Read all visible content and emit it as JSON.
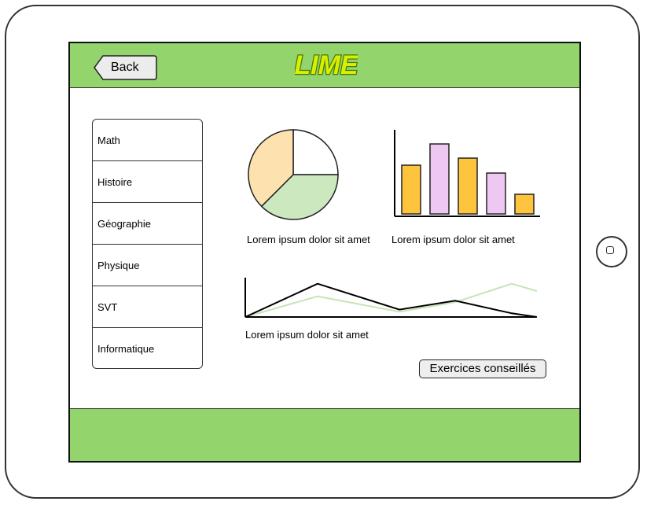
{
  "header": {
    "back_label": "Back",
    "logo_text": "LIME"
  },
  "sidebar": {
    "items": [
      {
        "label": "Math"
      },
      {
        "label": "Histoire"
      },
      {
        "label": "Géographie"
      },
      {
        "label": "Physique"
      },
      {
        "label": "SVT"
      },
      {
        "label": "Informatique"
      }
    ]
  },
  "charts": {
    "pie_caption": "Lorem ipsum dolor sit amet",
    "bar_caption": "Lorem ipsum dolor sit amet",
    "line_caption": "Lorem ipsum dolor sit amet"
  },
  "actions": {
    "exercises_label": "Exercices conseillés"
  },
  "colors": {
    "brand_green": "#93d46c",
    "pie_orange": "#fde2b0",
    "pie_green": "#cbe8bf",
    "bar_orange": "#ffc43d",
    "bar_purple": "#eec7f2",
    "line_dark": "#000000",
    "line_light": "#c6e4b8"
  },
  "icons": {
    "home": "home-button-icon",
    "back": "back-arrow-icon"
  },
  "chart_data": [
    {
      "type": "pie",
      "values": [
        25,
        37.5,
        37.5
      ],
      "colors": [
        "#ffffff",
        "#cbe8bf",
        "#fde2b0"
      ],
      "title": ""
    },
    {
      "type": "bar",
      "categories": [
        "1",
        "2",
        "3",
        "4",
        "5"
      ],
      "values": [
        62,
        89,
        71,
        52,
        25
      ],
      "colors": [
        "#ffc43d",
        "#eec7f2",
        "#ffc43d",
        "#eec7f2",
        "#ffc43d"
      ],
      "ylim": [
        0,
        100
      ]
    },
    {
      "type": "line",
      "x": [
        0,
        1,
        2,
        3,
        4,
        5
      ],
      "series": [
        {
          "values": [
            0,
            45,
            10,
            22,
            5,
            0
          ],
          "color": "#000000"
        },
        {
          "values": [
            0,
            28,
            7,
            20,
            45,
            35
          ],
          "color": "#c6e4b8"
        }
      ],
      "ylim": [
        0,
        50
      ]
    }
  ]
}
